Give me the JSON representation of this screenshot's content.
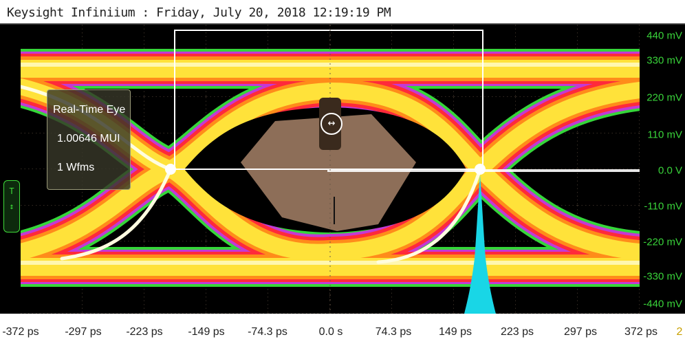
{
  "window": {
    "title": "Keysight Infiniium : Friday, July 20, 2018 12:19:19 PM"
  },
  "info_box": {
    "title": "Real-Time Eye",
    "ui_count": "1.00646 MUI",
    "waveforms": "1 Wfms"
  },
  "trigger_marker": {
    "icon": "trigger-icon"
  },
  "eye_mask_marker": {
    "icon": "horizontal-arrows-icon"
  },
  "y_axis": {
    "labels": [
      "440 mV",
      "330 mV",
      "220 mV",
      "110 mV",
      "0.0 V",
      "-110 mV",
      "-220 mV",
      "-330 mV",
      "-440 mV"
    ]
  },
  "x_axis": {
    "labels": [
      "-372 ps",
      "-297 ps",
      "-223 ps",
      "-149 ps",
      "-74.3 ps",
      "0.0 s",
      "74.3 ps",
      "149 ps",
      "223 ps",
      "297 ps",
      "372 ps",
      "2"
    ]
  },
  "colors": {
    "eye_hot": "#ffffff",
    "eye_warm": "#ffe23a",
    "eye_orange": "#ff8c1a",
    "eye_red": "#ff2a3a",
    "eye_edge": "#c23ad6",
    "eye_outer": "#35d63a",
    "mask": "#9c7a62",
    "histogram": "#19d6e6",
    "axis_green": "#39d33a"
  }
}
